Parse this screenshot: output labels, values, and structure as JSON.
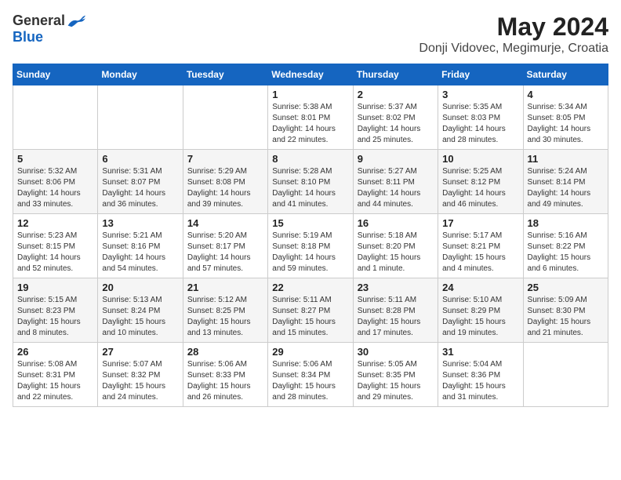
{
  "header": {
    "logo_general": "General",
    "logo_blue": "Blue",
    "month_title": "May 2024",
    "location": "Donji Vidovec, Megimurje, Croatia"
  },
  "days_of_week": [
    "Sunday",
    "Monday",
    "Tuesday",
    "Wednesday",
    "Thursday",
    "Friday",
    "Saturday"
  ],
  "weeks": [
    [
      {
        "day": "",
        "info": ""
      },
      {
        "day": "",
        "info": ""
      },
      {
        "day": "",
        "info": ""
      },
      {
        "day": "1",
        "info": "Sunrise: 5:38 AM\nSunset: 8:01 PM\nDaylight: 14 hours\nand 22 minutes."
      },
      {
        "day": "2",
        "info": "Sunrise: 5:37 AM\nSunset: 8:02 PM\nDaylight: 14 hours\nand 25 minutes."
      },
      {
        "day": "3",
        "info": "Sunrise: 5:35 AM\nSunset: 8:03 PM\nDaylight: 14 hours\nand 28 minutes."
      },
      {
        "day": "4",
        "info": "Sunrise: 5:34 AM\nSunset: 8:05 PM\nDaylight: 14 hours\nand 30 minutes."
      }
    ],
    [
      {
        "day": "5",
        "info": "Sunrise: 5:32 AM\nSunset: 8:06 PM\nDaylight: 14 hours\nand 33 minutes."
      },
      {
        "day": "6",
        "info": "Sunrise: 5:31 AM\nSunset: 8:07 PM\nDaylight: 14 hours\nand 36 minutes."
      },
      {
        "day": "7",
        "info": "Sunrise: 5:29 AM\nSunset: 8:08 PM\nDaylight: 14 hours\nand 39 minutes."
      },
      {
        "day": "8",
        "info": "Sunrise: 5:28 AM\nSunset: 8:10 PM\nDaylight: 14 hours\nand 41 minutes."
      },
      {
        "day": "9",
        "info": "Sunrise: 5:27 AM\nSunset: 8:11 PM\nDaylight: 14 hours\nand 44 minutes."
      },
      {
        "day": "10",
        "info": "Sunrise: 5:25 AM\nSunset: 8:12 PM\nDaylight: 14 hours\nand 46 minutes."
      },
      {
        "day": "11",
        "info": "Sunrise: 5:24 AM\nSunset: 8:14 PM\nDaylight: 14 hours\nand 49 minutes."
      }
    ],
    [
      {
        "day": "12",
        "info": "Sunrise: 5:23 AM\nSunset: 8:15 PM\nDaylight: 14 hours\nand 52 minutes."
      },
      {
        "day": "13",
        "info": "Sunrise: 5:21 AM\nSunset: 8:16 PM\nDaylight: 14 hours\nand 54 minutes."
      },
      {
        "day": "14",
        "info": "Sunrise: 5:20 AM\nSunset: 8:17 PM\nDaylight: 14 hours\nand 57 minutes."
      },
      {
        "day": "15",
        "info": "Sunrise: 5:19 AM\nSunset: 8:18 PM\nDaylight: 14 hours\nand 59 minutes."
      },
      {
        "day": "16",
        "info": "Sunrise: 5:18 AM\nSunset: 8:20 PM\nDaylight: 15 hours\nand 1 minute."
      },
      {
        "day": "17",
        "info": "Sunrise: 5:17 AM\nSunset: 8:21 PM\nDaylight: 15 hours\nand 4 minutes."
      },
      {
        "day": "18",
        "info": "Sunrise: 5:16 AM\nSunset: 8:22 PM\nDaylight: 15 hours\nand 6 minutes."
      }
    ],
    [
      {
        "day": "19",
        "info": "Sunrise: 5:15 AM\nSunset: 8:23 PM\nDaylight: 15 hours\nand 8 minutes."
      },
      {
        "day": "20",
        "info": "Sunrise: 5:13 AM\nSunset: 8:24 PM\nDaylight: 15 hours\nand 10 minutes."
      },
      {
        "day": "21",
        "info": "Sunrise: 5:12 AM\nSunset: 8:25 PM\nDaylight: 15 hours\nand 13 minutes."
      },
      {
        "day": "22",
        "info": "Sunrise: 5:11 AM\nSunset: 8:27 PM\nDaylight: 15 hours\nand 15 minutes."
      },
      {
        "day": "23",
        "info": "Sunrise: 5:11 AM\nSunset: 8:28 PM\nDaylight: 15 hours\nand 17 minutes."
      },
      {
        "day": "24",
        "info": "Sunrise: 5:10 AM\nSunset: 8:29 PM\nDaylight: 15 hours\nand 19 minutes."
      },
      {
        "day": "25",
        "info": "Sunrise: 5:09 AM\nSunset: 8:30 PM\nDaylight: 15 hours\nand 21 minutes."
      }
    ],
    [
      {
        "day": "26",
        "info": "Sunrise: 5:08 AM\nSunset: 8:31 PM\nDaylight: 15 hours\nand 22 minutes."
      },
      {
        "day": "27",
        "info": "Sunrise: 5:07 AM\nSunset: 8:32 PM\nDaylight: 15 hours\nand 24 minutes."
      },
      {
        "day": "28",
        "info": "Sunrise: 5:06 AM\nSunset: 8:33 PM\nDaylight: 15 hours\nand 26 minutes."
      },
      {
        "day": "29",
        "info": "Sunrise: 5:06 AM\nSunset: 8:34 PM\nDaylight: 15 hours\nand 28 minutes."
      },
      {
        "day": "30",
        "info": "Sunrise: 5:05 AM\nSunset: 8:35 PM\nDaylight: 15 hours\nand 29 minutes."
      },
      {
        "day": "31",
        "info": "Sunrise: 5:04 AM\nSunset: 8:36 PM\nDaylight: 15 hours\nand 31 minutes."
      },
      {
        "day": "",
        "info": ""
      }
    ]
  ]
}
